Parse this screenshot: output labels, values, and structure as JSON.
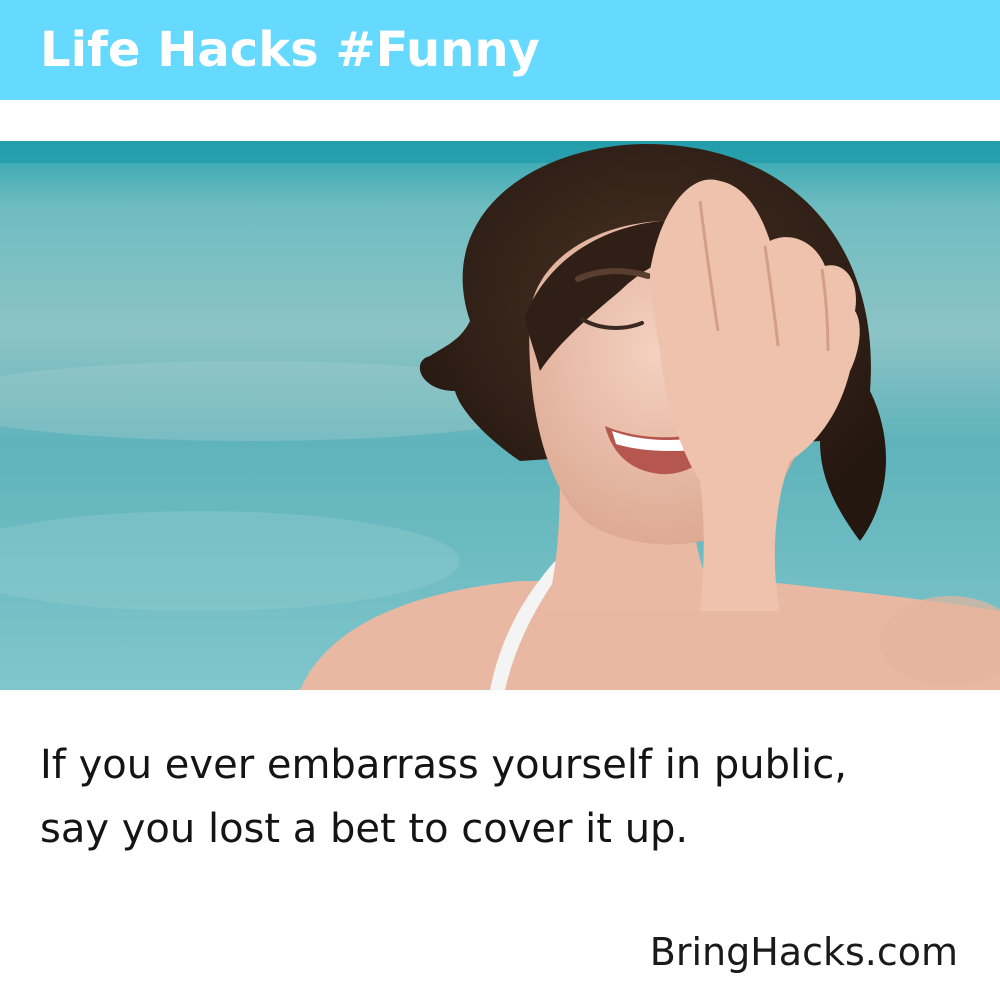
{
  "header": {
    "title": "Life Hacks #Funny",
    "background": "#66d9ff"
  },
  "photo": {
    "subject": "woman-facepalm-icon"
  },
  "caption": {
    "line1": "If you ever embarrass yourself in public,",
    "line2": "say you lost a bet to cover it up."
  },
  "footer": {
    "site": "BringHacks.com"
  }
}
